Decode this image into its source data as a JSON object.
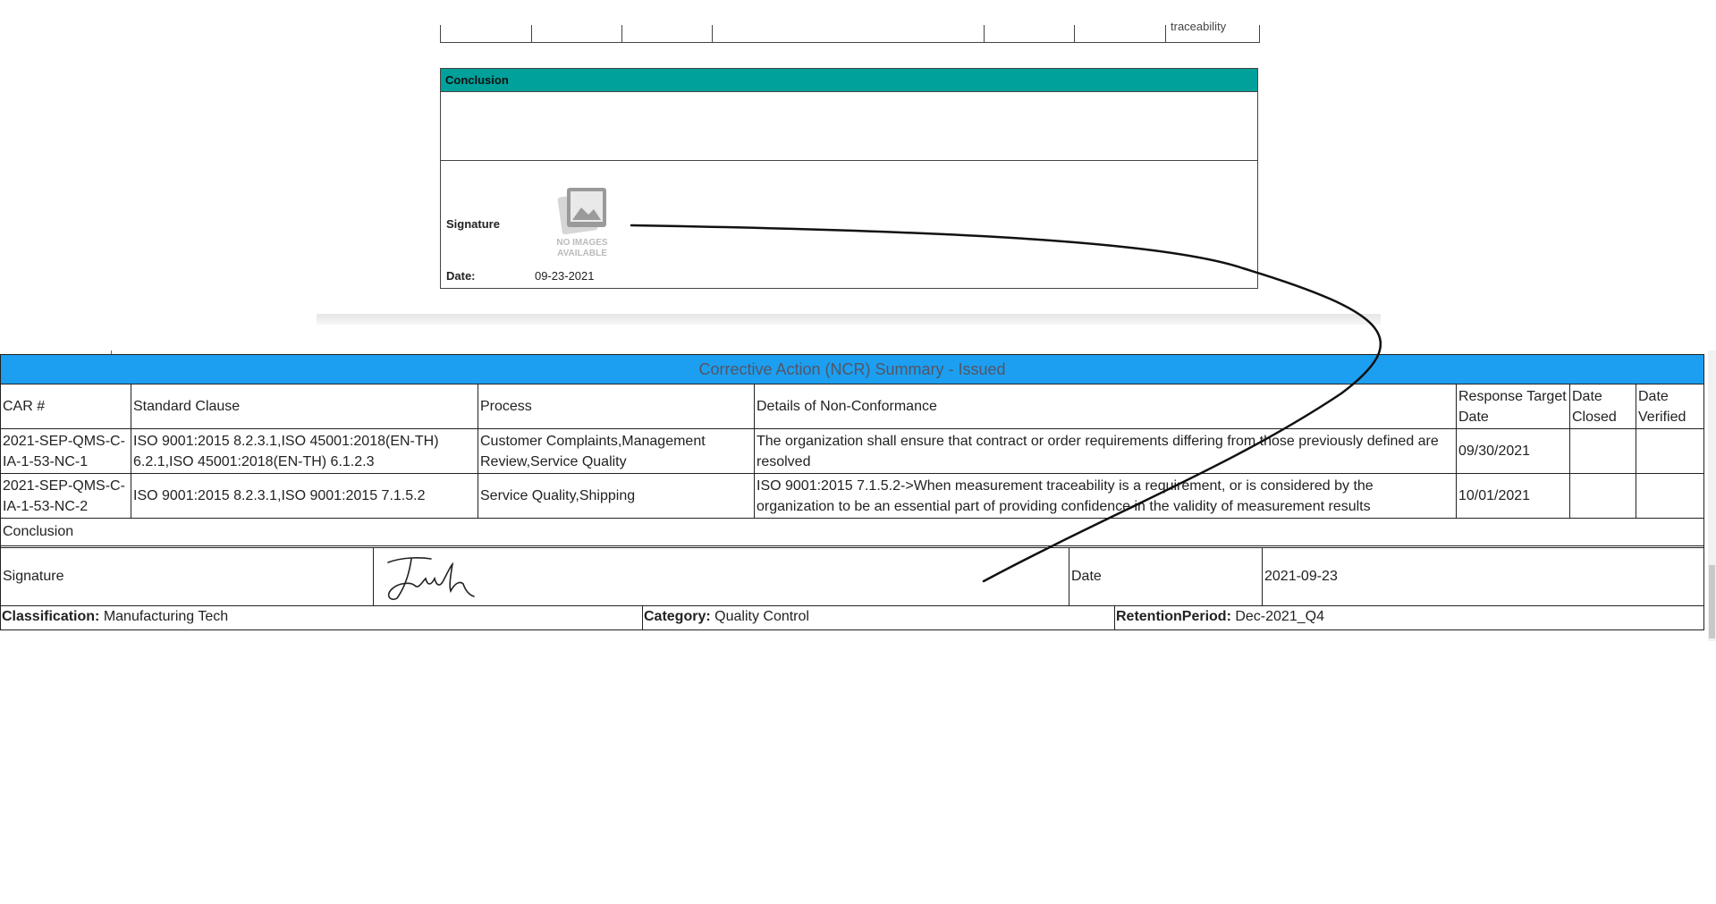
{
  "top_fragment": {
    "trailing_text": "traceability"
  },
  "conclusion_card": {
    "header": "Conclusion",
    "signature_label": "Signature",
    "no_image_text_1": "NO IMAGES",
    "no_image_text_2": "AVAILABLE",
    "date_label": "Date:",
    "date_value": "09-23-2021"
  },
  "summary": {
    "title": "Corrective Action (NCR) Summary - Issued",
    "title_color": "#1c9ff0",
    "columns": [
      "CAR #",
      "Standard Clause",
      "Process",
      "Details of Non-Conformance",
      "Response Target Date",
      "Date Closed",
      "Date Verified"
    ],
    "rows": [
      {
        "car": "2021-SEP-QMS-C-IA-1-53-NC-1",
        "clause": "ISO 9001:2015 8.2.3.1,ISO 45001:2018(EN-TH) 6.2.1,ISO 45001:2018(EN-TH) 6.1.2.3",
        "process": "Customer Complaints,Management Review,Service Quality",
        "details": "The organization shall ensure that contract or order requirements differing from those previously defined are resolved",
        "target": "09/30/2021",
        "closed": "",
        "verified": ""
      },
      {
        "car": "2021-SEP-QMS-C-IA-1-53-NC-2",
        "clause": "ISO 9001:2015 8.2.3.1,ISO 9001:2015 7.1.5.2",
        "process": "Service Quality,Shipping",
        "details": "ISO 9001:2015 7.1.5.2->When measurement traceability is a requirement, or is considered by the organization to be an essential part of providing confidence in the validity of measurement results",
        "target": "10/01/2021",
        "closed": "",
        "verified": ""
      }
    ],
    "conclusion_label": "Conclusion",
    "signature_label": "Signature",
    "date_label": "Date",
    "date_value": "2021-09-23",
    "classification_label": "Classification:",
    "classification_value": "Manufacturing Tech",
    "category_label": "Category:",
    "category_value": "Quality Control",
    "retention_label": "RetentionPeriod:",
    "retention_value": "Dec-2021_Q4"
  },
  "colors": {
    "teal_header": "#00a19a",
    "blue_title": "#1c9ff0"
  }
}
